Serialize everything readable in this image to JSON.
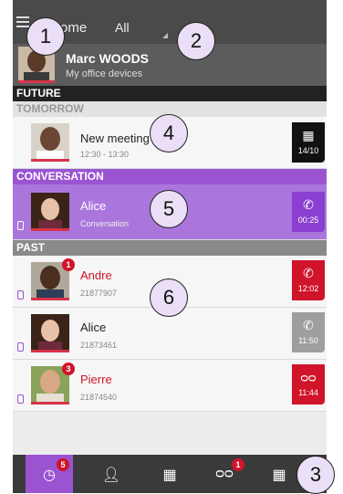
{
  "topbar": {
    "home_label": "ome",
    "filter_label": "All"
  },
  "profile": {
    "name": "Marc WOODS",
    "subtitle": "My office devices"
  },
  "sections": {
    "future": "FUTURE",
    "tomorrow": "TOMORROW",
    "conversation": "CONVERSATION",
    "past": "PAST"
  },
  "meeting": {
    "title": "New meeting",
    "time": "12:30 - 13:30",
    "tile_date": "14/10",
    "tile_color": "#111111"
  },
  "conversation": {
    "title": "Alice",
    "detail": "Conversation",
    "tile_time": "00:25",
    "tile_color": "#8a3fd0"
  },
  "past": [
    {
      "name": "Andre",
      "number": "21877907",
      "tile_time": "12:02",
      "badge": "1",
      "tile_color": "#d0142a",
      "missed": true
    },
    {
      "name": "Alice",
      "number": "21873461",
      "tile_time": "11:50",
      "badge": "",
      "tile_color": "#9e9e9e",
      "missed": false
    },
    {
      "name": "Pierre",
      "number": "21874540",
      "tile_time": "11:44",
      "badge": "3",
      "tile_color": "#d0142a",
      "missed": true
    }
  ],
  "bottom_tabs": [
    {
      "icon": "history-icon",
      "badge": "5",
      "active": true
    },
    {
      "icon": "contacts-icon",
      "badge": "",
      "active": false
    },
    {
      "icon": "dialpad-icon",
      "badge": "",
      "active": false
    },
    {
      "icon": "voicemail-icon",
      "badge": "1",
      "active": false
    },
    {
      "icon": "calendar-icon",
      "badge": "",
      "active": false
    }
  ],
  "callouts": [
    "1",
    "2",
    "3",
    "4",
    "5",
    "6"
  ],
  "colors": {
    "accent": "#9a54d2",
    "missed": "#d0142a"
  }
}
